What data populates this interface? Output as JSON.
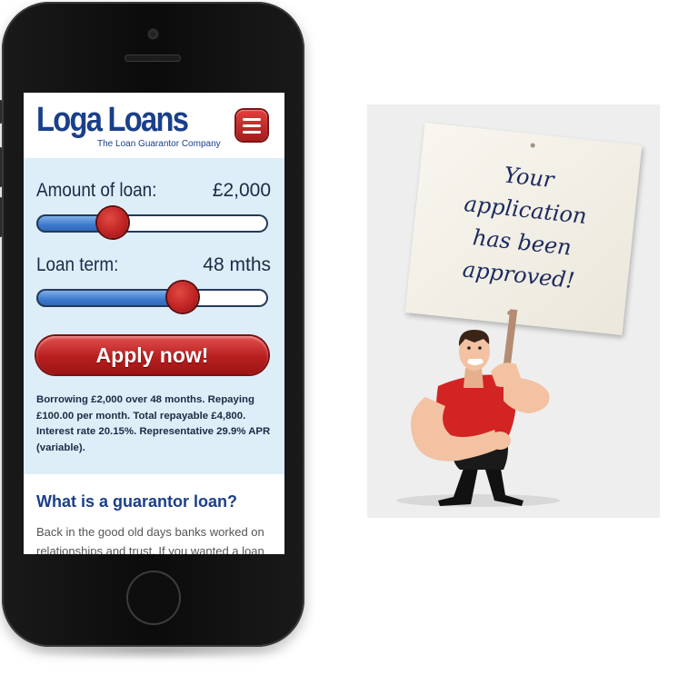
{
  "app": {
    "logo": {
      "name": "Loga Loans",
      "tagline": "The Loan Guarantor Company"
    }
  },
  "calculator": {
    "amount": {
      "label": "Amount of loan:",
      "value": "£2,000",
      "slider_fraction": 0.33
    },
    "term": {
      "label": "Loan term:",
      "value": "48 mths",
      "slider_fraction": 0.63
    },
    "apply_label": "Apply now!",
    "summary": "Borrowing £2,000 over 48 months. Repaying £100.00 per month. Total repayable £4,800. Interest rate 20.15%. Representative 29.9% APR (variable)."
  },
  "content": {
    "heading": "What is a guarantor loan?",
    "body": "Back in the good old days banks worked on relationships and trust. If you wanted a loan"
  },
  "illustration": {
    "sign_lines": [
      "Your",
      "application",
      "has been",
      "approved!"
    ]
  },
  "colors": {
    "brand_blue": "#1a3f8a",
    "accent_red": "#c02424",
    "panel_blue": "#ddeef9"
  },
  "icons": {
    "menu": "hamburger-menu-icon"
  }
}
